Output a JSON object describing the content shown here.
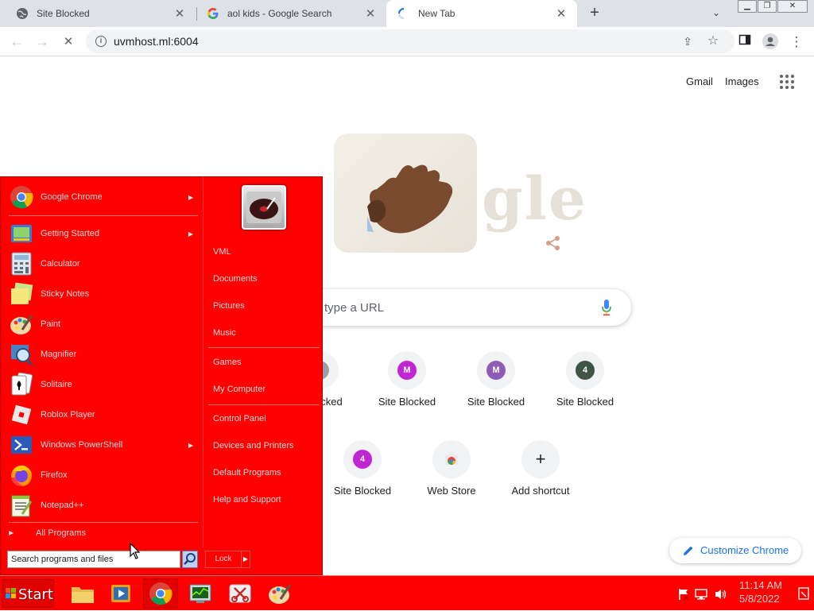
{
  "browser": {
    "tabs": [
      {
        "title": "Site Blocked",
        "icon": "globe-icon",
        "active": false
      },
      {
        "title": "aol kids - Google Search",
        "icon": "google-icon",
        "active": false
      },
      {
        "title": "New Tab",
        "icon": "loading-icon",
        "active": true
      }
    ],
    "address": "uvmhost.ml:6004"
  },
  "ntp": {
    "gmail": "Gmail",
    "images": "Images",
    "search_placeholder": "type a URL",
    "logo_text": "gle",
    "shortcuts": [
      {
        "label": "ocked",
        "badge": "",
        "color": "#9aa0a6"
      },
      {
        "label": "Site Blocked",
        "badge": "M",
        "color": "#c026d3"
      },
      {
        "label": "Site Blocked",
        "badge": "M",
        "color": "#8e5cb6"
      },
      {
        "label": "Site Blocked",
        "badge": "4",
        "color": "#3f5444"
      },
      {
        "label": "Site Blocked",
        "badge": "4",
        "color": "#c026d3"
      },
      {
        "label": "Web Store",
        "badge": "",
        "color": "#f1f3f4"
      },
      {
        "label": "Add shortcut",
        "badge": "+",
        "color": "#f1f3f4"
      }
    ],
    "customize": "Customize Chrome"
  },
  "start_menu": {
    "programs": [
      {
        "label": "Google Chrome",
        "icon": "chrome-icon",
        "arrow": true
      },
      {
        "label": "Getting Started",
        "icon": "getting-started-icon",
        "arrow": true
      },
      {
        "label": "Calculator",
        "icon": "calculator-icon",
        "arrow": false
      },
      {
        "label": "Sticky Notes",
        "icon": "sticky-notes-icon",
        "arrow": false
      },
      {
        "label": "Paint",
        "icon": "paint-icon",
        "arrow": false
      },
      {
        "label": "Magnifier",
        "icon": "magnifier-icon",
        "arrow": false
      },
      {
        "label": "Solitaire",
        "icon": "solitaire-icon",
        "arrow": false
      },
      {
        "label": "Roblox Player",
        "icon": "roblox-icon",
        "arrow": false
      },
      {
        "label": "Windows PowerShell",
        "icon": "powershell-icon",
        "arrow": true
      },
      {
        "label": "Firefox",
        "icon": "firefox-icon",
        "arrow": false
      },
      {
        "label": "Notepad++",
        "icon": "notepadpp-icon",
        "arrow": false
      }
    ],
    "all_programs": "All Programs",
    "right_items": [
      "VML",
      "Documents",
      "Pictures",
      "Music",
      "Games",
      "My Computer",
      "Control Panel",
      "Devices and Printers",
      "Default Programs",
      "Help and Support"
    ],
    "search_placeholder": "Search programs and files",
    "lock_label": "Lock"
  },
  "taskbar": {
    "start_label": "Start",
    "apps": [
      "folder-icon",
      "media-player-icon",
      "chrome-icon",
      "task-manager-icon",
      "snipping-tool-icon",
      "paint-icon"
    ],
    "time": "11:14 AM",
    "date": "5/8/2022"
  },
  "colors": {
    "menu_red": "#ff0000",
    "link_blue": "#1a73e8"
  }
}
